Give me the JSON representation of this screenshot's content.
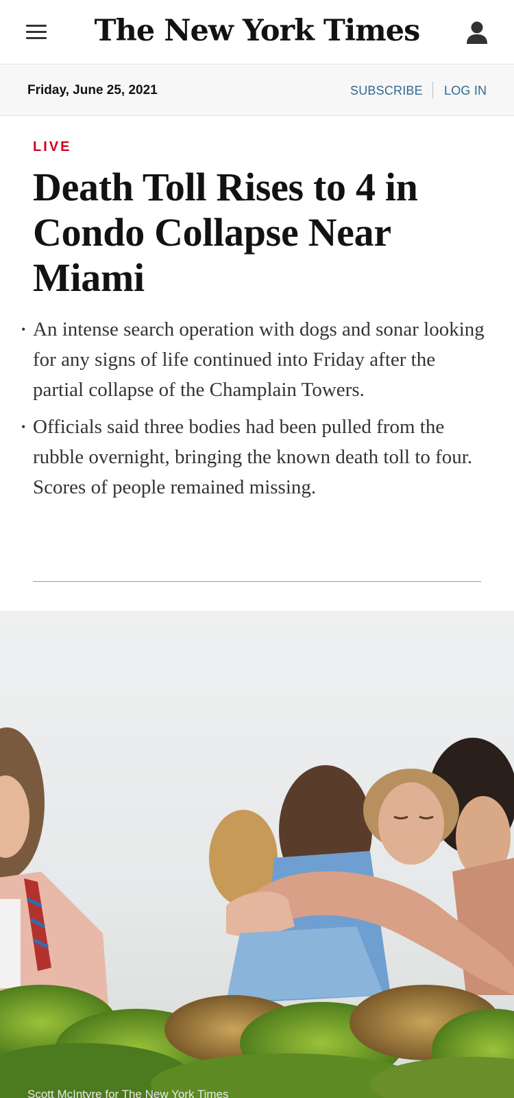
{
  "header": {
    "menu_icon": "hamburger-menu-icon",
    "logo_text": "The New York Times",
    "account_icon": "user-account-icon"
  },
  "datebar": {
    "date": "Friday, June 25, 2021",
    "subscribe_label": "SUBSCRIBE",
    "login_label": "LOG IN",
    "link_color": "#326891"
  },
  "article": {
    "live_label": "LIVE",
    "live_color": "#d0021b",
    "headline": "Death Toll Rises to 4 in Condo Collapse Near Miami",
    "summary": [
      "An intense search operation with dogs and sonar looking for any signs of life continued into Friday after the partial collapse of the Champlain Towers.",
      "Officials said three bodies had been pulled from the rubble overnight, bringing the known death toll to four. Scores of people remained missing."
    ],
    "photo_credit": "Scott McIntyre for The New York Times"
  }
}
